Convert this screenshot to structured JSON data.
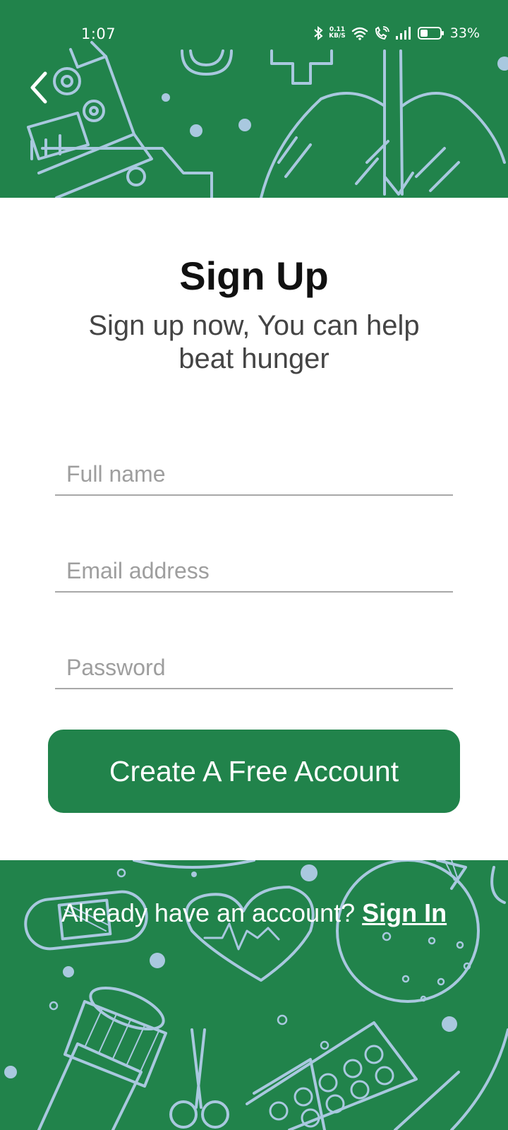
{
  "status_bar": {
    "time": "1:07",
    "net_speed_value": "0.11",
    "net_speed_unit": "KB/S",
    "battery_percent": "33%",
    "icons": [
      "bluetooth-icon",
      "wifi-icon",
      "wifi-calling-icon",
      "signal-icon",
      "battery-icon"
    ]
  },
  "header": {
    "back_icon": "chevron-left-icon"
  },
  "main": {
    "title": "Sign Up",
    "subtitle": "Sign up now, You can help beat hunger",
    "fields": {
      "full_name_placeholder": "Full name",
      "email_placeholder": "Email address",
      "password_placeholder": "Password"
    },
    "cta_label": "Create A Free Account"
  },
  "footer": {
    "prompt": "Already have an account?",
    "link": "Sign In"
  },
  "colors": {
    "brand_green": "#21834b",
    "doodle_line": "#a9c8df",
    "input_underline": "#a8a8a8",
    "placeholder": "#9e9e9e"
  }
}
